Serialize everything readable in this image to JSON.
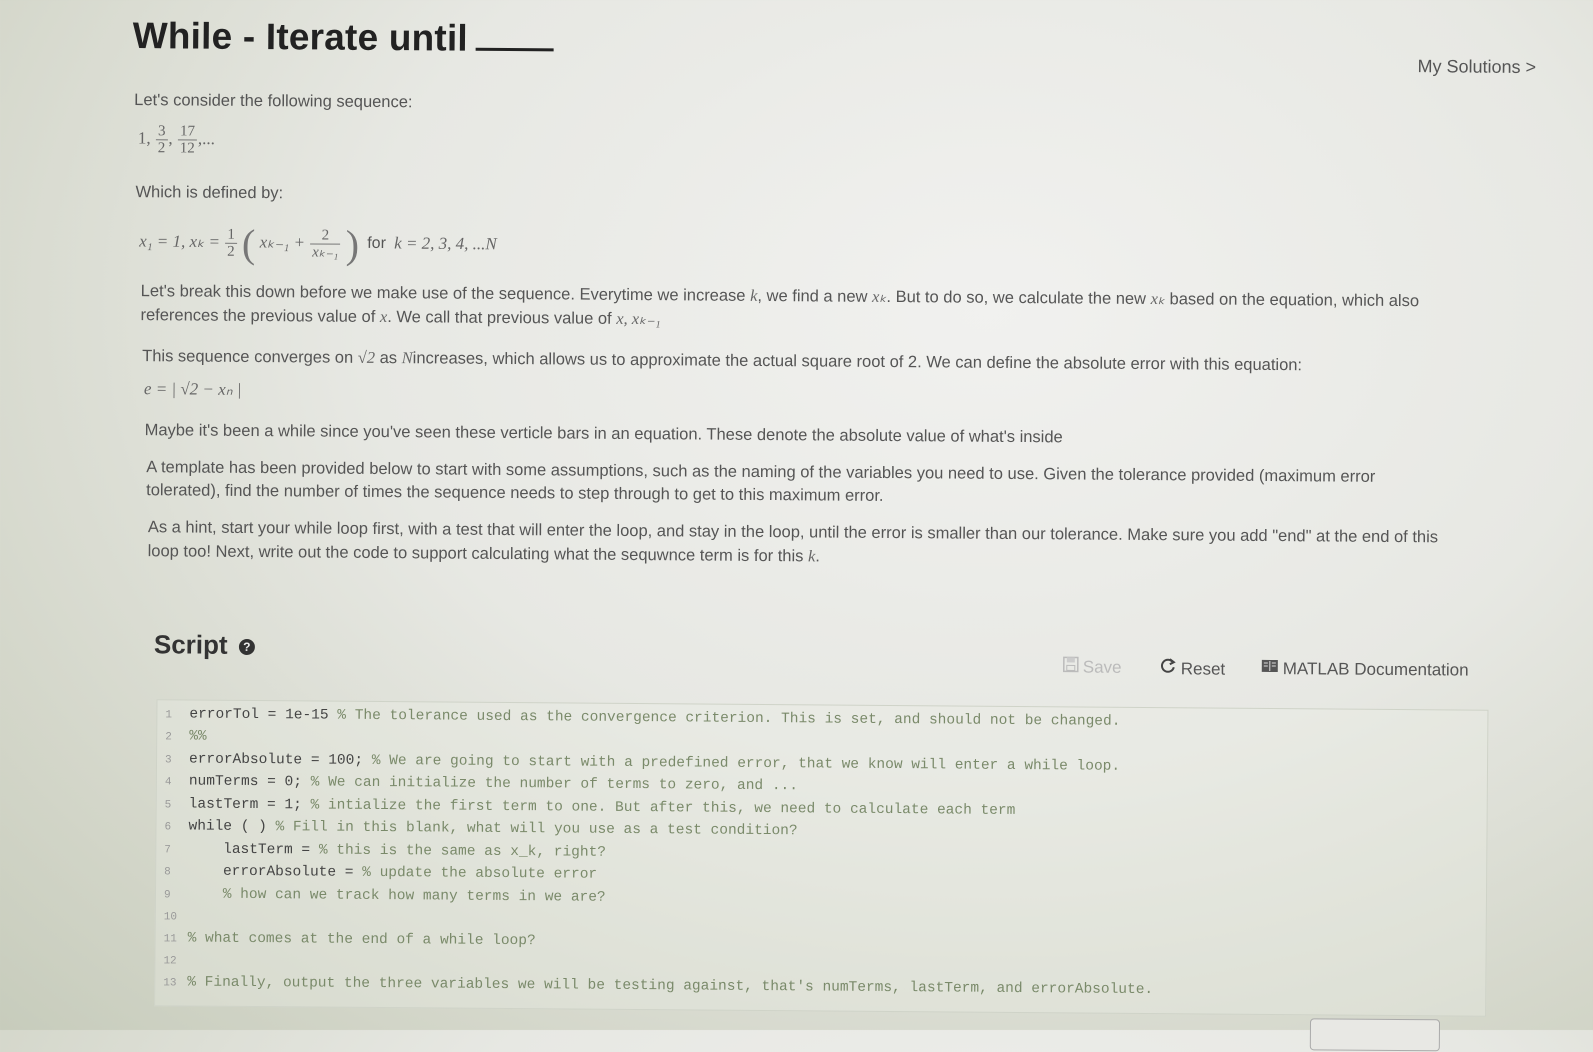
{
  "header": {
    "title": "While - Iterate until",
    "my_solutions": "My Solutions",
    "chevron": ">"
  },
  "problem": {
    "intro": "Let's consider the following sequence:",
    "sequence": {
      "first": "1,",
      "f1_num": "3",
      "f1_den": "2",
      "f2_num": "17",
      "f2_den": "12",
      "ellipsis": ",..."
    },
    "defined_by": "Which is defined by:",
    "definition": {
      "part1": "x₁ = 1, xₖ =",
      "half_num": "1",
      "half_den": "2",
      "inner1": "xₖ₋₁ +",
      "two_num": "2",
      "two_den": "xₖ₋₁",
      "for_text": "for",
      "range": "k = 2, 3, 4, ...N"
    },
    "p_breakdown_a": "Let's break this down before we make use of the sequence.  Everytime we increase",
    "p_breakdown_k": "k",
    "p_breakdown_b": ", we find a new",
    "p_breakdown_xk": "xₖ",
    "p_breakdown_c": ". But to do so, we calculate the new",
    "p_breakdown_xk2": "xₖ",
    "p_breakdown_d": "based on the equation, which also references the previous value of",
    "p_breakdown_x": "x",
    "p_breakdown_e": ".  We call that previous value of",
    "p_breakdown_x2": "x, xₖ₋₁",
    "p_converge_a": "This sequence converges on",
    "p_converge_sqrt": "√2",
    "p_converge_b": "as",
    "p_converge_n": "N",
    "p_converge_c": "increases, which allows us to approximate the actual square root of 2.  We can define the absolute error with this equation:",
    "error_eq": "e = | √2 − xₙ |",
    "p_bars": "Maybe it's been a while since you've seen these verticle bars in an equation.  These denote the absolute value of what's inside",
    "p_template": "A template has been provided below to start with some assumptions, such as the naming of the variables you need to use.  Given the tolerance provided (maximum error tolerated), find the number of times the sequence needs to step through to get to this maximum error.",
    "p_hint_a": "As a hint, start your while loop first, with a test that will enter the loop, and stay in the loop, until the error is smaller than our tolerance.  Make sure you add \"end\" at the end of this loop too!  Next, write out the code to support calculating what the sequwnce term is for this",
    "p_hint_k": "k",
    "p_hint_end": "."
  },
  "script": {
    "heading": "Script",
    "help": "?",
    "save_label": "Save",
    "reset_label": "Reset",
    "docs_label": "MATLAB Documentation"
  },
  "code": {
    "lines": [
      {
        "n": "1",
        "code": "errorTol = 1e-15 ",
        "comment": "% The tolerance used as the convergence criterion. This is set, and should not be changed."
      },
      {
        "n": "2",
        "code": "",
        "comment": "%%"
      },
      {
        "n": "3",
        "code": "errorAbsolute = 100; ",
        "comment": "% We are going to start with a predefined error, that we know will enter a while loop."
      },
      {
        "n": "4",
        "code": "numTerms = 0; ",
        "comment": "% We can initialize the number of terms to zero, and ..."
      },
      {
        "n": "5",
        "code": "lastTerm = 1; ",
        "comment": "% intialize the first term to one. But after this, we need to calculate each term"
      },
      {
        "n": "6",
        "code": "while ( ) ",
        "comment": "% Fill in this blank, what will you use as a test condition?"
      },
      {
        "n": "7",
        "code": "    lastTerm = ",
        "comment": "% this is the same as x_k, right?"
      },
      {
        "n": "8",
        "code": "    errorAbsolute = ",
        "comment": "% update the absolute error"
      },
      {
        "n": "9",
        "code": "    ",
        "comment": "% how can we track how many terms in we are?"
      },
      {
        "n": "10",
        "code": "",
        "comment": ""
      },
      {
        "n": "11",
        "code": "",
        "comment": "% what comes at the end of a while loop?"
      },
      {
        "n": "12",
        "code": "",
        "comment": ""
      },
      {
        "n": "13",
        "code": "",
        "comment": "% Finally, output the three variables we will be testing against, that's numTerms, lastTerm, and errorAbsolute."
      }
    ]
  }
}
